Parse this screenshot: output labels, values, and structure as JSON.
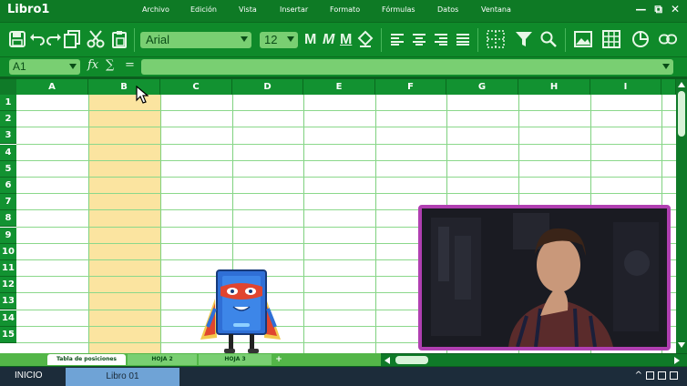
{
  "app": {
    "title": "Libro1"
  },
  "menu": {
    "items": [
      "Archivo",
      "Edición",
      "Vista",
      "Insertar",
      "Formato",
      "Fórmulas",
      "Datos",
      "Ventana"
    ]
  },
  "window_controls": {
    "minimize": "—",
    "restore": "⧉",
    "close": "✕"
  },
  "toolbar": {
    "font_name": "Arial",
    "font_size": "12",
    "bold_letter": "M",
    "italic_letter": "M",
    "underline_letter": "M",
    "icons": [
      "save-icon",
      "undo-icon",
      "redo-icon",
      "copy-icon",
      "cut-icon",
      "paste-icon",
      "fill-icon",
      "align-left-icon",
      "align-center-icon",
      "align-right-icon",
      "justify-icon",
      "borders-icon",
      "filter-icon",
      "search-icon",
      "image-icon",
      "table-icon",
      "chart-icon",
      "link-icon"
    ]
  },
  "formula_bar": {
    "cell_ref": "A1",
    "fx_label": "fx",
    "sum_label": "∑",
    "equals_label": "=",
    "formula_value": ""
  },
  "grid": {
    "columns": [
      "A",
      "B",
      "C",
      "D",
      "E",
      "F",
      "G",
      "H",
      "I"
    ],
    "rows": [
      "1",
      "2",
      "3",
      "4",
      "5",
      "6",
      "7",
      "8",
      "9",
      "10",
      "11",
      "12",
      "13",
      "14",
      "15"
    ],
    "highlighted_column": "B"
  },
  "sheet_tabs": {
    "tabs": [
      "Tabla de posiciones",
      "HOJA 2",
      "HOJA 3"
    ],
    "add_label": "+",
    "active_index": 0
  },
  "taskbar": {
    "start_label": "INICIO",
    "task_item": "Libro 01",
    "tray_up": "^"
  },
  "colors": {
    "menu_bg": "#0e7a25",
    "toolbar_bg": "#0f8a2a",
    "header_bg": "#129231",
    "input_bg": "#79cf72",
    "highlight_col": "#fbe4a0",
    "gridline": "#8bd88b",
    "video_border": "#b03fb1",
    "taskbar_bg": "#1c2c3a",
    "taskbar_item": "#6fa3d6"
  }
}
